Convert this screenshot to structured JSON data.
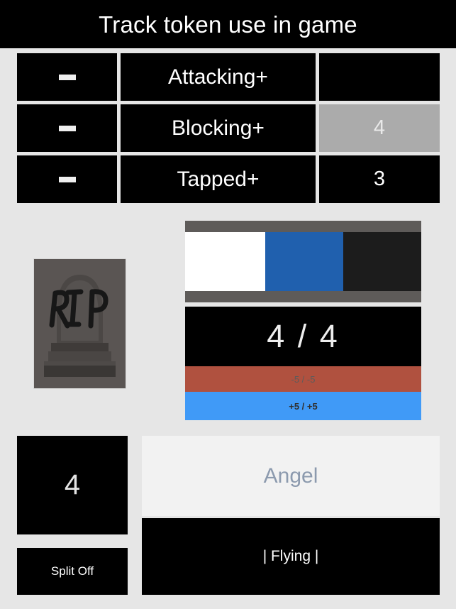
{
  "header": {
    "title": "Track token use in game"
  },
  "status_table": {
    "rows": [
      {
        "decrement_label": "–",
        "label": "Attacking+",
        "value": "",
        "selected": false
      },
      {
        "decrement_label": "–",
        "label": "Blocking+",
        "value": "4",
        "selected": true
      },
      {
        "decrement_label": "–",
        "label": "Tapped+",
        "value": "3",
        "selected": false
      }
    ]
  },
  "graveyard": {
    "icon": "tombstone-rip-image",
    "inscription": "RIP"
  },
  "creature": {
    "mana_bar": {
      "frame_color": "#5e5b59",
      "segments": [
        {
          "name": "white-mana",
          "color": "#ffffff",
          "width_pct": 34
        },
        {
          "name": "blue-mana",
          "color": "#2060ae",
          "width_pct": 33
        },
        {
          "name": "black-mana",
          "color": "#1c1c1c",
          "width_pct": 33
        }
      ]
    },
    "power_toughness": "4 / 4",
    "decrement_label": "-5 / -5",
    "increment_label": "+5 / +5",
    "decrement_color": "#b0513f",
    "increment_color": "#409af7"
  },
  "footer": {
    "token_count": "4",
    "split_off_label": "Split Off",
    "name_placeholder": "Angel",
    "name_value": "",
    "abilities": "| Flying |"
  },
  "colors": {
    "background": "#e6e6e6",
    "panel_black": "#000000",
    "selected_gray": "#ababab",
    "field_gray": "#f2f2f2",
    "placeholder_text": "#8c9aae"
  }
}
